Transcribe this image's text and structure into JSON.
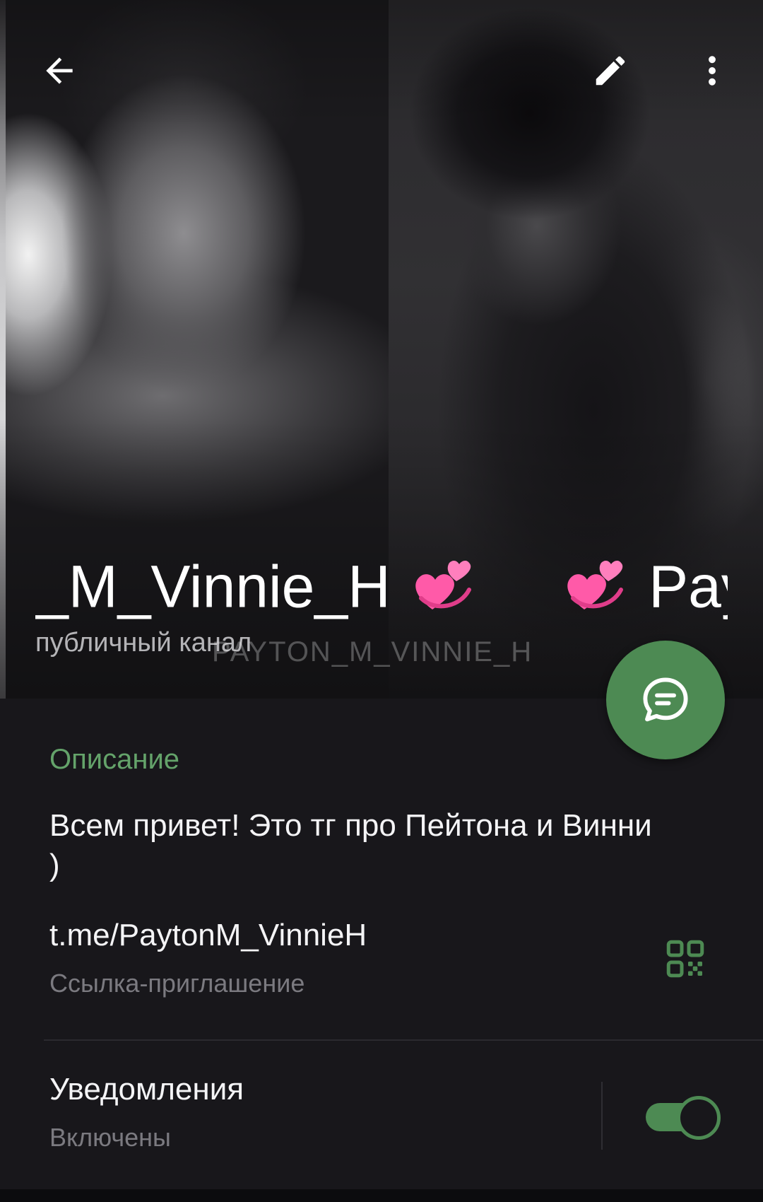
{
  "header": {
    "title": "_M_Vinnie_H 💞 💞 Pay",
    "title_part1": "_M_Vinnie_H",
    "title_part2": "Pay",
    "subtitle": "публичный канал",
    "watermark": "PAYTON_M_VINNIE_H",
    "back_icon": "arrow-left-icon",
    "edit_icon": "pencil-icon",
    "more_icon": "more-vertical-icon",
    "heart_icon": "revolving-hearts-icon"
  },
  "fab": {
    "icon": "chat-bubble-icon"
  },
  "info": {
    "section_label": "Описание",
    "description": "Всем привет! Это тг про Пейтона и Винни )",
    "link": {
      "value": "t.me/PaytonM_VinnieH",
      "caption": "Ссылка-приглашение",
      "icon": "qr-code-icon"
    },
    "notifications": {
      "title": "Уведомления",
      "status": "Включены",
      "enabled": true
    }
  },
  "colors": {
    "accent": "#4d8a53",
    "section_label": "#64a36a",
    "background": "#18171b",
    "primary_text": "#f4f4f6",
    "secondary_text": "#7b7a80",
    "heart_pink": "#ff5aa8"
  }
}
